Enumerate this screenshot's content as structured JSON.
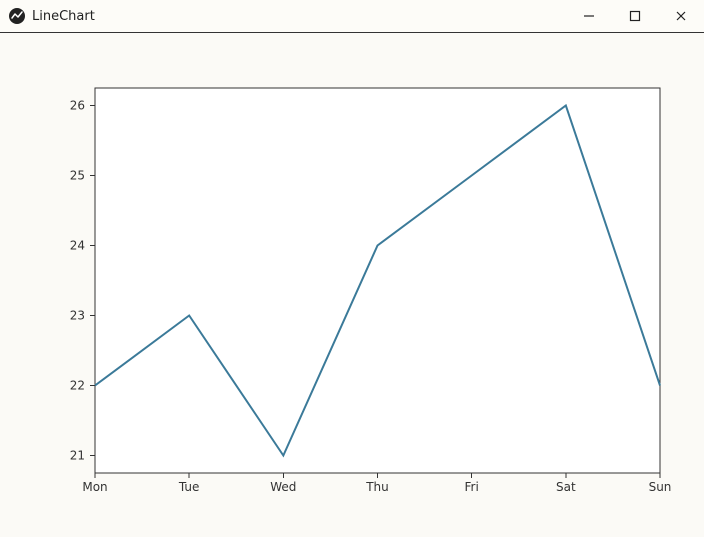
{
  "window": {
    "title": "LineChart",
    "controls": {
      "minimize": "–",
      "maximize": "☐",
      "close": "✕"
    }
  },
  "chart_data": {
    "type": "line",
    "categories": [
      "Mon",
      "Tue",
      "Wed",
      "Thu",
      "Fri",
      "Sat",
      "Sun"
    ],
    "values": [
      22,
      23,
      21,
      24,
      25,
      26,
      22
    ],
    "y_ticks": [
      21,
      22,
      23,
      24,
      25,
      26
    ],
    "ylim": [
      20.75,
      26.25
    ],
    "title": "",
    "xlabel": "",
    "ylabel": ""
  }
}
